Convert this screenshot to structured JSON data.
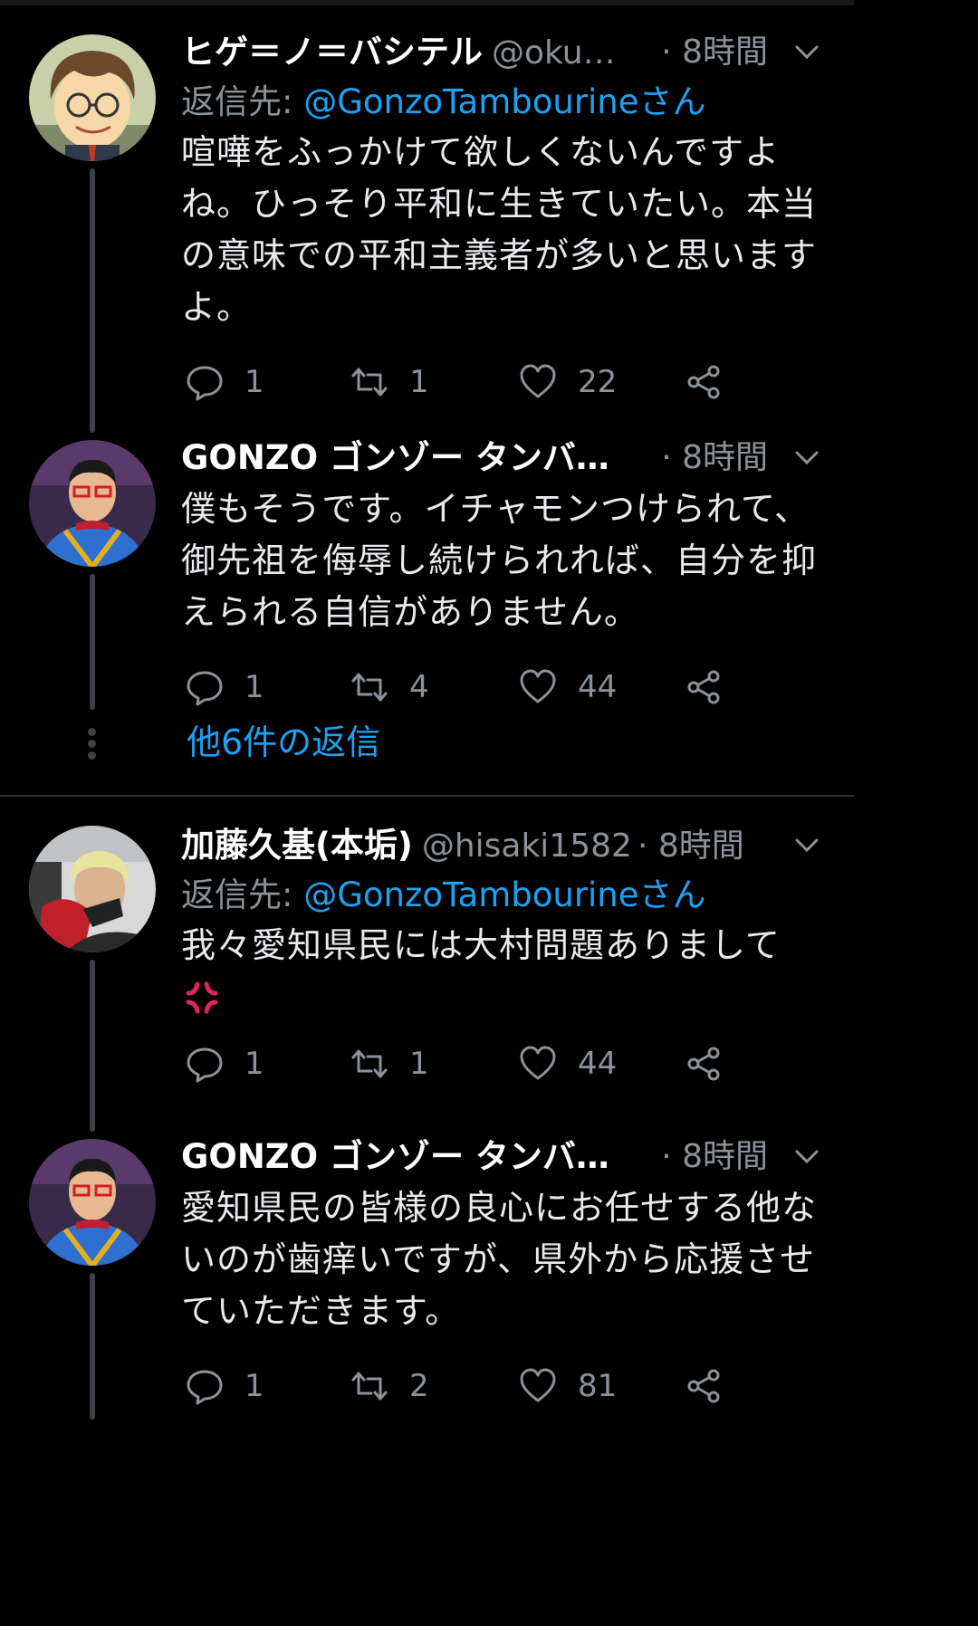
{
  "threads": [
    {
      "tweets": [
        {
          "name": "ヒゲ＝ノ＝バシテル",
          "handle": "@oku…",
          "time": "· 8時間",
          "reply_prefix": "返信先: ",
          "reply_link": "@GonzoTambourineさん",
          "body": "喧嘩をふっかけて欲しくないんですよね。ひっそり平和に生きていたい。本当の意味での平和主義者が多いと思いますよ。",
          "stats": {
            "replies": "1",
            "retweets": "1",
            "likes": "22"
          }
        },
        {
          "name": "GONZO ゴンゾー タンバ…",
          "handle": "",
          "time": "· 8時間",
          "body": "僕もそうです。イチャモンつけられて、御先祖を侮辱し続けられれば、自分を抑えられる自信がありません。",
          "stats": {
            "replies": "1",
            "retweets": "4",
            "likes": "44"
          }
        }
      ],
      "more_replies": "他6件の返信"
    },
    {
      "tweets": [
        {
          "name": "加藤久基(本垢)",
          "handle": "@hisaki1582",
          "time": "· 8時間",
          "reply_prefix": "返信先: ",
          "reply_link": "@GonzoTambourineさん",
          "body": "我々愛知県民には大村問題ありまして",
          "emoji": "anger-symbol",
          "stats": {
            "replies": "1",
            "retweets": "1",
            "likes": "44"
          }
        },
        {
          "name": "GONZO ゴンゾー タンバ…",
          "handle": "",
          "time": "· 8時間",
          "body": "愛知県民の皆様の良心にお任せする他ないのが歯痒いですが、県外から応援させていただきます。",
          "stats": {
            "replies": "1",
            "retweets": "2",
            "likes": "81"
          }
        }
      ]
    }
  ],
  "colors": {
    "link": "#1da1f2",
    "muted": "#8b9299",
    "anger": "#e0245e"
  }
}
